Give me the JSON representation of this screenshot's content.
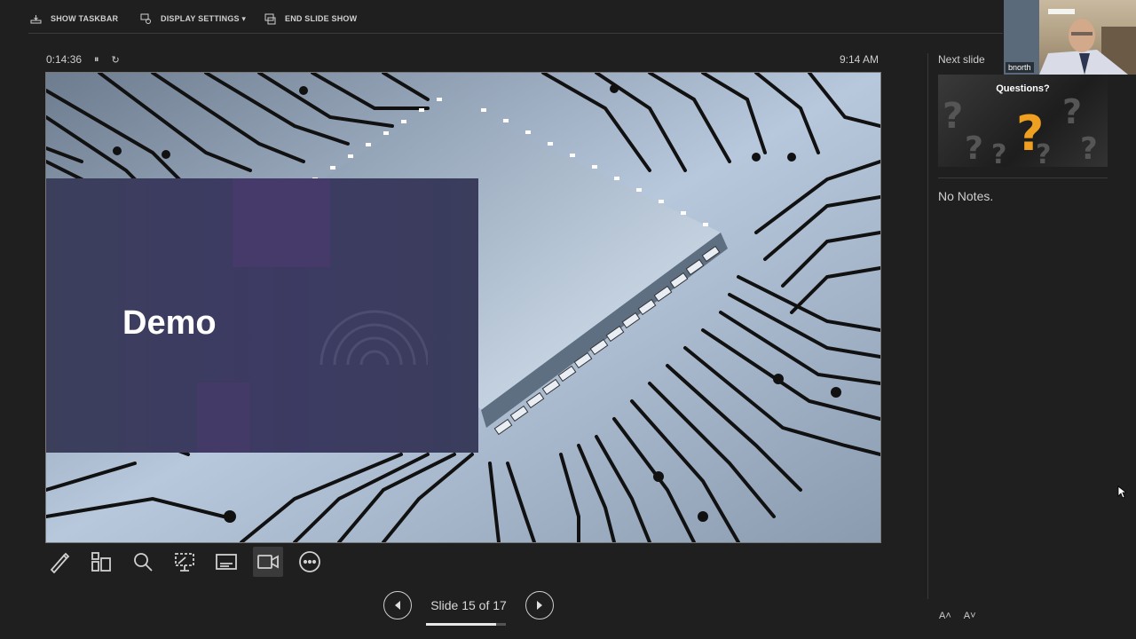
{
  "toolbar": {
    "show_taskbar": "SHOW TASKBAR",
    "display_settings": "DISPLAY SETTINGS ▾",
    "end_slide_show": "END SLIDE SHOW"
  },
  "timer": {
    "elapsed": "0:14:36",
    "pause_icon": "⏸",
    "restart_icon": "↻"
  },
  "clock": "9:14 AM",
  "slide": {
    "title": "Demo"
  },
  "tools": [
    "pen-icon",
    "see-all-slides-icon",
    "zoom-icon",
    "pointer-screen-icon",
    "subtitles-icon",
    "camera-icon",
    "more-options-icon"
  ],
  "navigation": {
    "slide_label": "Slide 15 of 17",
    "current": 15,
    "total": 17
  },
  "next_slide": {
    "label": "Next slide",
    "title": "Questions?"
  },
  "notes": "No Notes.",
  "font_controls": {
    "increase": "A˄",
    "decrease": "A˅"
  },
  "webcam": {
    "name": "bnorth"
  },
  "colors": {
    "background": "#1f1f1f",
    "panel": "#3b3f5c",
    "accent_purple": "#483b6c"
  }
}
